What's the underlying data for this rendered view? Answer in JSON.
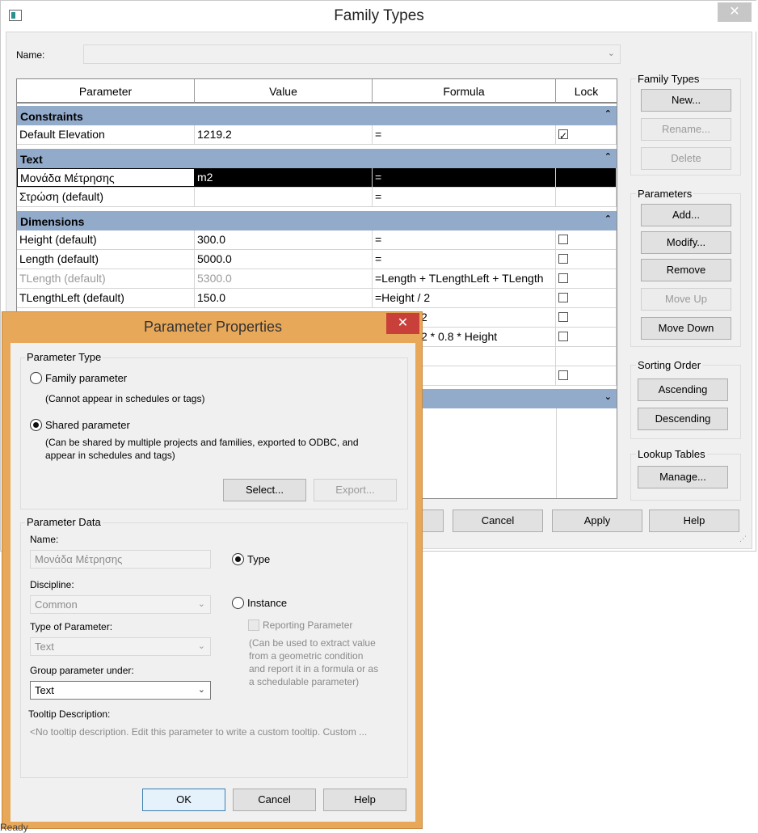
{
  "family_types_window": {
    "title": "Family Types",
    "close_glyph": "✕",
    "name_label": "Name:",
    "name_value": "",
    "grid": {
      "columns": [
        "Parameter",
        "Value",
        "Formula",
        "Lock"
      ],
      "groups": [
        {
          "name": "Constraints",
          "collapse_glyph": "⌃",
          "rows": [
            {
              "parameter": "Default Elevation",
              "value": "1219.2",
              "formula": "=",
              "lock": "checked"
            }
          ]
        },
        {
          "name": "Text",
          "collapse_glyph": "⌃",
          "rows": [
            {
              "parameter": "Μονάδα Μέτρησης",
              "value": "m2",
              "formula": "=",
              "lock": "none"
            },
            {
              "parameter": "Στρώση (default)",
              "value": "",
              "formula": "=",
              "lock": "none"
            }
          ]
        },
        {
          "name": "Dimensions",
          "collapse_glyph": "⌃",
          "rows": [
            {
              "parameter": "Height (default)",
              "value": "300.0",
              "formula": "=",
              "lock": "unchecked"
            },
            {
              "parameter": "Length (default)",
              "value": "5000.0",
              "formula": "=",
              "lock": "unchecked"
            },
            {
              "parameter": "TLength (default)",
              "value": "5300.0",
              "formula": "=Length + TLengthLeft + TLength",
              "lock": "unchecked"
            },
            {
              "parameter": "TLengthLeft (default)",
              "value": "150.0",
              "formula": "=Height / 2",
              "lock": "unchecked"
            }
          ]
        }
      ],
      "partial_rows": [
        {
          "formula": "2",
          "lock": "unchecked"
        },
        {
          "formula": "2 * 0.8 * Height",
          "lock": "unchecked"
        },
        {
          "formula": "",
          "lock": "none"
        },
        {
          "formula": "",
          "lock": "unchecked"
        }
      ],
      "expand_glyph": "⌄"
    },
    "family_types_panel": {
      "title": "Family Types",
      "new": "New...",
      "rename": "Rename...",
      "delete": "Delete"
    },
    "parameters_panel": {
      "title": "Parameters",
      "add": "Add...",
      "modify": "Modify...",
      "remove": "Remove",
      "move_up": "Move Up",
      "move_down": "Move Down"
    },
    "sorting_panel": {
      "title": "Sorting Order",
      "ascending": "Ascending",
      "descending": "Descending"
    },
    "lookup_panel": {
      "title": "Lookup Tables",
      "manage": "Manage..."
    },
    "bottom_buttons": {
      "cancel": "Cancel",
      "apply": "Apply",
      "help": "Help"
    }
  },
  "parameter_properties_dialog": {
    "title": "Parameter Properties",
    "close_glyph": "✕",
    "parameter_type": {
      "group_title": "Parameter Type",
      "family_parameter": "Family parameter",
      "family_parameter_note": "(Cannot appear in schedules or tags)",
      "shared_parameter": "Shared parameter",
      "shared_parameter_note_line1": "(Can be shared by multiple projects and families, exported to ODBC, and",
      "shared_parameter_note_line2": "appear in schedules and tags)",
      "selected": "shared",
      "select_button": "Select...",
      "export_button": "Export..."
    },
    "parameter_data": {
      "group_title": "Parameter Data",
      "name_label": "Name:",
      "name_value": "Μονάδα Μέτρησης",
      "discipline_label": "Discipline:",
      "discipline_value": "Common",
      "type_of_parameter_label": "Type of Parameter:",
      "type_of_parameter_value": "Text",
      "group_under_label": "Group parameter under:",
      "group_under_value": "Text",
      "type_option": "Type",
      "instance_option": "Instance",
      "selected_scope": "type",
      "reporting_parameter": "Reporting Parameter",
      "reporting_note_lines": [
        "(Can be used to extract value",
        "from a geometric condition",
        "and report it in a formula or as",
        "a schedulable parameter)"
      ],
      "tooltip_label": "Tooltip Description:",
      "tooltip_value": "<No tooltip description. Edit this parameter to write a custom tooltip. Custom ..."
    },
    "buttons": {
      "ok": "OK",
      "cancel": "Cancel",
      "help": "Help"
    }
  },
  "status_bar": {
    "text": "Ready"
  }
}
